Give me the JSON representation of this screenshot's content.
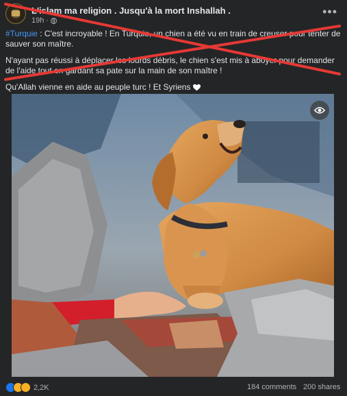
{
  "post": {
    "page_name": "L'islam ma religion . Jusqu'à la mort Inshallah .",
    "time": "19h",
    "more_icon": "ellipsis-icon",
    "privacy_icon": "globe-icon",
    "body": {
      "hashtag": "#Turquie",
      "p1": " : C'est incroyable ! En Turquie, un chien a été vu en train de creuser pour tenter de sauver son maître.",
      "p2": "N'ayant pas réussi à déplacer les lourds débris, le chien s'est mis à aboyer pour demander de l'aide tout en gardant sa pate sur la main de son maître !",
      "p3": "Qu'Allah vienne en aide au peuple turc ! Et Syriens"
    },
    "overlay_cross_color": "#e53935"
  },
  "photo": {
    "subject": "golden retriever barking on rubble with paw on a person's hand",
    "hide_icon": "eye-slash-icon"
  },
  "footer": {
    "reaction_icons": [
      "like-icon",
      "sad-icon",
      "care-icon"
    ],
    "reaction_count": "2,2K",
    "comments": "184 comments",
    "shares": "200 shares"
  }
}
